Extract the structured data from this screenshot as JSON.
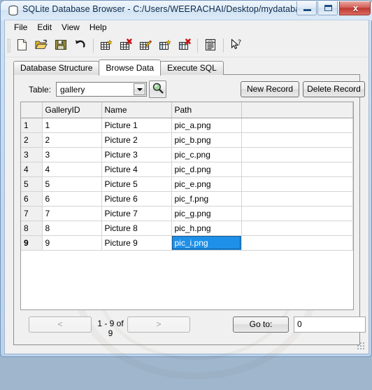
{
  "window": {
    "title": "SQLite Database Browser - C:/Users/WEERACHAI/Desktop/mydatabase",
    "app_icon": "database-icon",
    "controls": {
      "minimize": "minimize-icon",
      "maximize": "restore-icon",
      "close_label": "x"
    },
    "close_color": "#bf3931"
  },
  "menubar": {
    "items": [
      {
        "label": "File"
      },
      {
        "label": "Edit"
      },
      {
        "label": "View"
      },
      {
        "label": "Help"
      }
    ]
  },
  "toolbar": {
    "buttons": [
      {
        "icon": "new-database-icon"
      },
      {
        "icon": "open-database-icon"
      },
      {
        "icon": "save-icon"
      },
      {
        "icon": "undo-icon"
      },
      {
        "icon": "create-table-icon"
      },
      {
        "icon": "delete-table-icon"
      },
      {
        "icon": "modify-table-icon"
      },
      {
        "icon": "create-index-icon"
      },
      {
        "icon": "delete-index-icon"
      },
      {
        "icon": "log-icon"
      },
      {
        "icon": "help-cursor-icon"
      }
    ]
  },
  "tabs": [
    {
      "label": "Database Structure",
      "active": false
    },
    {
      "label": "Browse Data",
      "active": true
    },
    {
      "label": "Execute SQL",
      "active": false
    }
  ],
  "controls": {
    "table_label": "Table:",
    "table_value": "gallery",
    "dropdown_icon": "chevron-down-icon",
    "search_icon": "magnifier-icon",
    "new_record_label": "New Record",
    "delete_record_label": "Delete Record"
  },
  "grid": {
    "columns": [
      {
        "label": "GalleryID",
        "bold": false
      },
      {
        "label": "Name",
        "bold": false
      },
      {
        "label": "Path",
        "bold": true
      }
    ],
    "rows": [
      {
        "num": "1",
        "id": "1",
        "name": "Picture 1",
        "path": "pic_a.png"
      },
      {
        "num": "2",
        "id": "2",
        "name": "Picture 2",
        "path": "pic_b.png"
      },
      {
        "num": "3",
        "id": "3",
        "name": "Picture 3",
        "path": "pic_c.png"
      },
      {
        "num": "4",
        "id": "4",
        "name": "Picture 4",
        "path": "pic_d.png"
      },
      {
        "num": "5",
        "id": "5",
        "name": "Picture 5",
        "path": "pic_e.png"
      },
      {
        "num": "6",
        "id": "6",
        "name": "Picture 6",
        "path": "pic_f.png"
      },
      {
        "num": "7",
        "id": "7",
        "name": "Picture 7",
        "path": "pic_g.png"
      },
      {
        "num": "8",
        "id": "8",
        "name": "Picture 8",
        "path": "pic_h.png"
      },
      {
        "num": "9",
        "id": "9",
        "name": "Picture 9",
        "path": "pic_i.png"
      }
    ],
    "selected_row": 9,
    "selected_column": "Path",
    "selection_color": "#1e90e8"
  },
  "navigation": {
    "prev_label": "<",
    "next_label": ">",
    "range_label": "1 - 9 of 9",
    "goto_label": "Go to:",
    "goto_value": "0"
  }
}
